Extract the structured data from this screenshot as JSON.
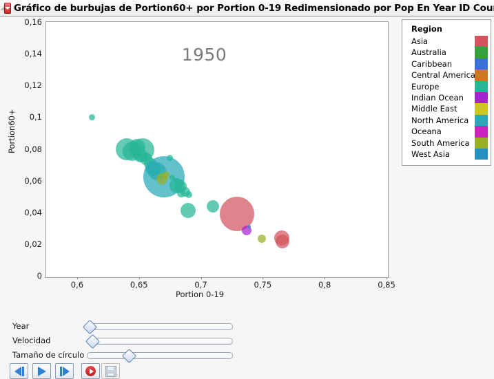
{
  "window": {
    "title": "Gráfico de burbujas de Portion60+ por Portion 0-19 Redimensionado por Pop En Year ID Country",
    "disclosure_icon": "triangle-collapse-icon",
    "menu_icon": "red-dropdown-triangle-icon"
  },
  "chart_data": {
    "type": "scatter",
    "title": "Gráfico de burbujas de Portion60+ por Portion 0-19 Redimensionado por Pop En Year ID Country",
    "annotation": "1950",
    "xlabel": "Portion 0-19",
    "ylabel": "Portion60+",
    "xlim": [
      0.575,
      0.85
    ],
    "ylim": [
      0,
      0.16
    ],
    "grid": false,
    "xticks": [
      "0,6",
      "0,65",
      "0,7",
      "0,75",
      "0,8",
      "0,85"
    ],
    "xtick_values": [
      0.6,
      0.65,
      0.7,
      0.75,
      0.8,
      0.85
    ],
    "yticks": [
      "0",
      "0,02",
      "0,04",
      "0,06",
      "0,08",
      "0,1",
      "0,12",
      "0,14",
      "0,16"
    ],
    "ytick_values": [
      0,
      0.02,
      0.04,
      0.06,
      0.08,
      0.1,
      0.12,
      0.14,
      0.16
    ],
    "size_encoding": "Pop",
    "color_encoding": "Region",
    "legend_position": "right",
    "points": [
      {
        "x": 0.6122,
        "y": 0.0998,
        "r": 4.5,
        "region": "Europe"
      },
      {
        "x": 0.6402,
        "y": 0.08,
        "r": 16,
        "region": "Europe"
      },
      {
        "x": 0.6445,
        "y": 0.0785,
        "r": 14,
        "region": "Europe"
      },
      {
        "x": 0.6485,
        "y": 0.0812,
        "r": 12,
        "region": "Europe"
      },
      {
        "x": 0.653,
        "y": 0.0793,
        "r": 17,
        "region": "Europe"
      },
      {
        "x": 0.6512,
        "y": 0.076,
        "r": 10,
        "region": "Europe"
      },
      {
        "x": 0.6557,
        "y": 0.0737,
        "r": 9,
        "region": "Europe"
      },
      {
        "x": 0.6588,
        "y": 0.0705,
        "r": 9,
        "region": "Europe"
      },
      {
        "x": 0.6612,
        "y": 0.0678,
        "r": 11,
        "region": "Europe"
      },
      {
        "x": 0.6648,
        "y": 0.066,
        "r": 13,
        "region": "Europe"
      },
      {
        "x": 0.67,
        "y": 0.0625,
        "r": 30,
        "region": "North America"
      },
      {
        "x": 0.6683,
        "y": 0.061,
        "r": 8,
        "region": "South America"
      },
      {
        "x": 0.6718,
        "y": 0.0638,
        "r": 5,
        "region": "South America"
      },
      {
        "x": 0.6752,
        "y": 0.0745,
        "r": 4.5,
        "region": "Europe"
      },
      {
        "x": 0.677,
        "y": 0.062,
        "r": 4,
        "region": "Europe"
      },
      {
        "x": 0.68,
        "y": 0.06,
        "r": 4,
        "region": "Europe"
      },
      {
        "x": 0.6805,
        "y": 0.057,
        "r": 11,
        "region": "Europe"
      },
      {
        "x": 0.6838,
        "y": 0.0565,
        "r": 9,
        "region": "Europe"
      },
      {
        "x": 0.684,
        "y": 0.052,
        "r": 6,
        "region": "Europe"
      },
      {
        "x": 0.6875,
        "y": 0.053,
        "r": 7,
        "region": "Europe"
      },
      {
        "x": 0.69,
        "y": 0.051,
        "r": 5,
        "region": "Europe"
      },
      {
        "x": 0.6895,
        "y": 0.0412,
        "r": 11,
        "region": "Europe"
      },
      {
        "x": 0.7095,
        "y": 0.0438,
        "r": 9,
        "region": "Europe"
      },
      {
        "x": 0.729,
        "y": 0.0392,
        "r": 25,
        "region": "Asia"
      },
      {
        "x": 0.7368,
        "y": 0.0288,
        "r": 7,
        "region": "Indian Ocean"
      },
      {
        "x": 0.739,
        "y": 0.0312,
        "r": 2.5,
        "region": "Caribbean"
      },
      {
        "x": 0.7495,
        "y": 0.0232,
        "r": 6,
        "region": "South America"
      },
      {
        "x": 0.7655,
        "y": 0.0238,
        "r": 11,
        "region": "Asia"
      },
      {
        "x": 0.766,
        "y": 0.0218,
        "r": 10,
        "region": "Asia"
      }
    ]
  },
  "legend": {
    "title": "Region",
    "items": [
      {
        "label": "Asia",
        "color": "#d2545f"
      },
      {
        "label": "Australia",
        "color": "#34a13c"
      },
      {
        "label": "Caribbean",
        "color": "#3b72d9"
      },
      {
        "label": "Central America",
        "color": "#cb7820"
      },
      {
        "label": "Europe",
        "color": "#27b597"
      },
      {
        "label": "Indian Ocean",
        "color": "#a623d1"
      },
      {
        "label": "Middle East",
        "color": "#cbc623"
      },
      {
        "label": "North America",
        "color": "#27a9b8"
      },
      {
        "label": "Oceana",
        "color": "#cb23bd"
      },
      {
        "label": "South America",
        "color": "#9aaf25"
      },
      {
        "label": "West Asia",
        "color": "#2492c0"
      }
    ]
  },
  "controls": {
    "sliders": [
      {
        "label": "Year",
        "value_pct": 1
      },
      {
        "label": "Velocidad",
        "value_pct": 3
      },
      {
        "label": "Tamaño de círculo",
        "value_pct": 28
      }
    ],
    "buttons": [
      {
        "name": "step-back-button",
        "icon": "step-backward-icon",
        "disabled": false
      },
      {
        "name": "play-button",
        "icon": "play-icon",
        "disabled": false
      },
      {
        "name": "step-forward-button",
        "icon": "step-forward-icon",
        "disabled": false
      },
      {
        "name": "record-button",
        "icon": "record-icon",
        "disabled": false
      },
      {
        "name": "save-button",
        "icon": "floppy-disk-icon",
        "disabled": true
      }
    ]
  }
}
